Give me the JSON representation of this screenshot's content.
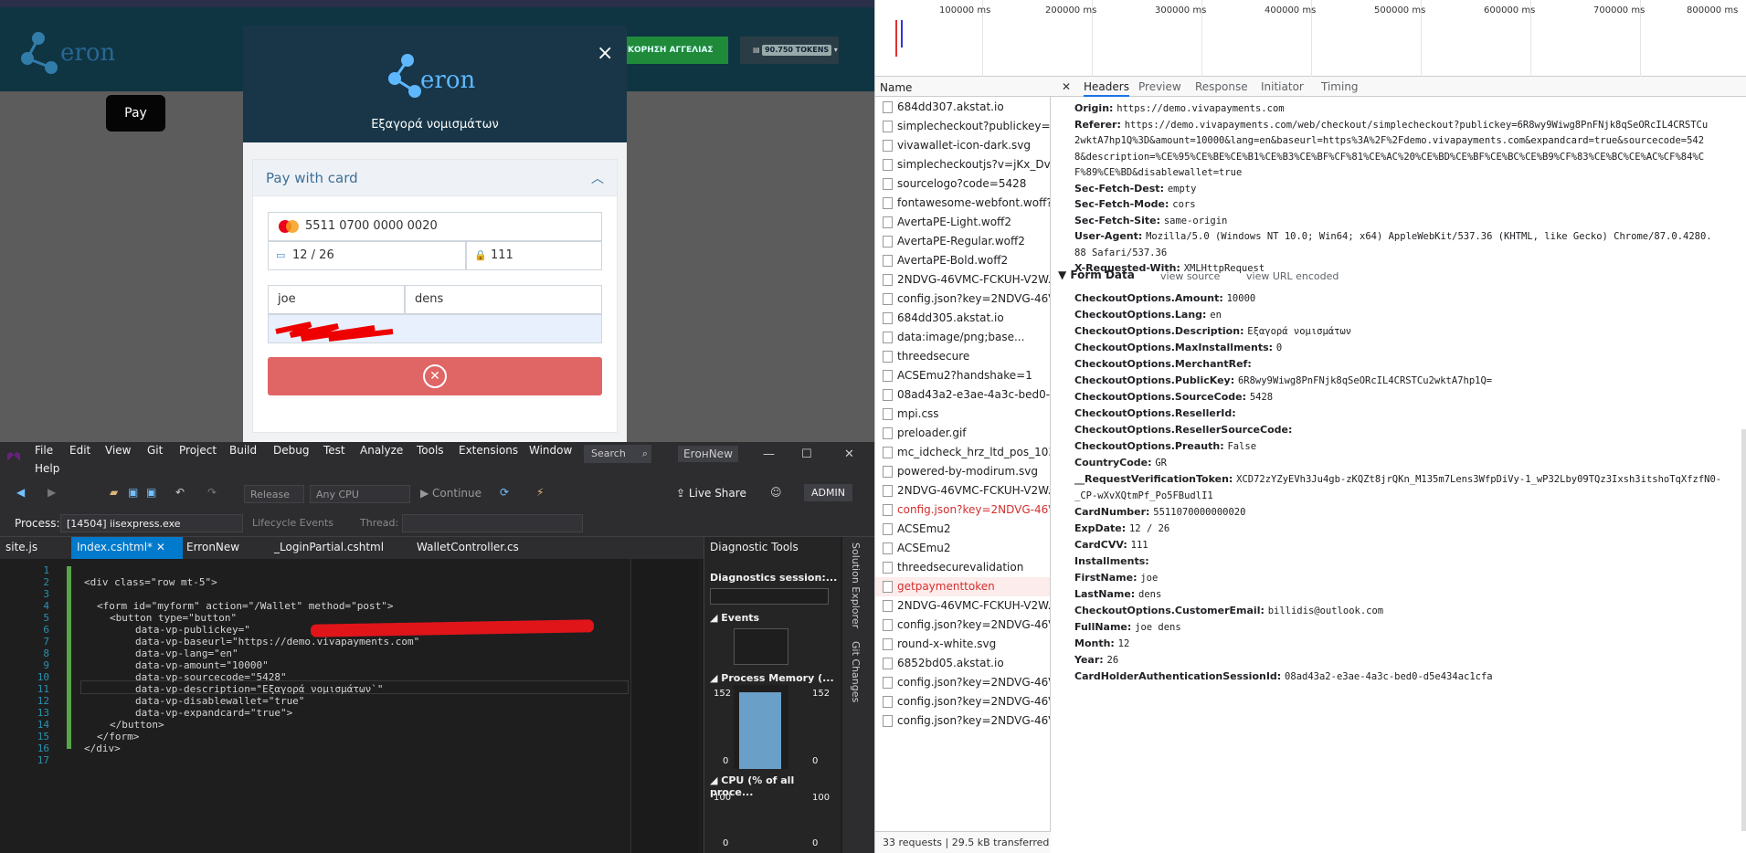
{
  "webpage": {
    "cta_label": "ΚΟΡΗΣΗ ΑΓΓΕΛΙΑΣ",
    "tokens_label": "90.750 TOKENS",
    "pay_button": "Pay",
    "modal": {
      "close": "×",
      "title": "Εξαγορά νομισμάτων",
      "panel_title": "Pay with card",
      "card_number": "5511 0700 0000 0020",
      "expiry": "12 / 26",
      "cvv": "111",
      "first_name": "joe",
      "last_name": "dens"
    }
  },
  "vs": {
    "menu": [
      "File",
      "Edit",
      "View",
      "Git",
      "Project",
      "Build",
      "Debug",
      "Test",
      "Analyze",
      "Tools",
      "Extensions",
      "Window",
      "Help"
    ],
    "search_placeholder": "Search",
    "solution": "ErонNew",
    "live_share": "Live Share",
    "admin": "ADMIN",
    "config": "Release",
    "platform": "Any CPU",
    "continue": "Continue",
    "process_label": "Process:",
    "process": "[14504] iisexpress.exe",
    "lifecycle": "Lifecycle Events",
    "thread_label": "Thread:",
    "tabs": [
      "site.js",
      "Index.cshtml*",
      "ErronNew",
      "_LoginPartial.cshtml",
      "WalletController.cs"
    ],
    "code_lines": [
      {
        "n": "1",
        "t": ""
      },
      {
        "n": "2",
        "t": "<div class=\"row mt-5\">"
      },
      {
        "n": "3",
        "t": ""
      },
      {
        "n": "4",
        "t": "<form id=\"myform\" action=\"/Wallet\" method=\"post\">"
      },
      {
        "n": "5",
        "t": "<button type=\"button\""
      },
      {
        "n": "6",
        "t": "data-vp-publickey=\""
      },
      {
        "n": "7",
        "t": "data-vp-baseurl=\"https://demo.vivapayments.com\""
      },
      {
        "n": "8",
        "t": "data-vp-lang=\"en\""
      },
      {
        "n": "9",
        "t": "data-vp-amount=\"10000\""
      },
      {
        "n": "10",
        "t": "data-vp-sourcecode=\"5428\""
      },
      {
        "n": "11",
        "t": "data-vp-description=\"Εξαγορά νομισμάτων`\""
      },
      {
        "n": "12",
        "t": "data-vp-disablewallet=\"true\""
      },
      {
        "n": "13",
        "t": "data-vp-expandcard=\"true\">"
      },
      {
        "n": "14",
        "t": "</button>"
      },
      {
        "n": "15",
        "t": "</form>"
      },
      {
        "n": "16",
        "t": "</div>"
      },
      {
        "n": "17",
        "t": ""
      }
    ],
    "diagnostic_title": "Diagnostic Tools",
    "diag_session": "Diagnostics session:...",
    "events": "Events",
    "process_memory": "Process Memory (...",
    "cpu": "CPU (% of all proce...",
    "mem_max": "152",
    "mem_min": "0",
    "cpu_max": "100",
    "cpu_min": "0",
    "side_tabs": [
      "Solution Explorer",
      "Git Changes"
    ]
  },
  "devtools": {
    "timeline_ticks": [
      "100000 ms",
      "200000 ms",
      "300000 ms",
      "400000 ms",
      "500000 ms",
      "600000 ms",
      "700000 ms",
      "800000 ms"
    ],
    "name_header": "Name",
    "requests": [
      {
        "name": "684dd307.akstat.io",
        "error": false
      },
      {
        "name": "simplecheckout?publickey=6...",
        "error": false
      },
      {
        "name": "vivawallet-icon-dark.svg",
        "error": false
      },
      {
        "name": "simplecheckoutjs?v=jKx_DvU...",
        "error": false
      },
      {
        "name": "sourcelogo?code=5428",
        "error": false
      },
      {
        "name": "fontawesome-webfont.woff?...",
        "error": false
      },
      {
        "name": "AvertaPE-Light.woff2",
        "error": false
      },
      {
        "name": "AvertaPE-Regular.woff2",
        "error": false
      },
      {
        "name": "AvertaPE-Bold.woff2",
        "error": false
      },
      {
        "name": "2NDVG-46VMC-FCKUH-V2W...",
        "error": false
      },
      {
        "name": "config.json?key=2NDVG-46V...",
        "error": false
      },
      {
        "name": "684dd305.akstat.io",
        "error": false
      },
      {
        "name": "data:image/png;base...",
        "error": false
      },
      {
        "name": "threedsecure",
        "error": false
      },
      {
        "name": "ACSEmu2?handshake=1",
        "error": false
      },
      {
        "name": "08ad43a2-e3ae-4a3c-bed0-d...",
        "error": false
      },
      {
        "name": "mpi.css",
        "error": false
      },
      {
        "name": "preloader.gif",
        "error": false
      },
      {
        "name": "mc_idcheck_hrz_ltd_pos_103...",
        "error": false
      },
      {
        "name": "powered-by-modirum.svg",
        "error": false
      },
      {
        "name": "2NDVG-46VMC-FCKUH-V2W...",
        "error": false
      },
      {
        "name": "config.json?key=2NDVG-46V...",
        "error": true
      },
      {
        "name": "ACSEmu2",
        "error": false
      },
      {
        "name": "ACSEmu2",
        "error": false
      },
      {
        "name": "threedsecurevalidation",
        "error": false
      },
      {
        "name": "getpaymenttoken",
        "error": true
      },
      {
        "name": "2NDVG-46VMC-FCKUH-V2W...",
        "error": false
      },
      {
        "name": "config.json?key=2NDVG-46V...",
        "error": false
      },
      {
        "name": "round-x-white.svg",
        "error": false
      },
      {
        "name": "6852bd05.akstat.io",
        "error": false
      },
      {
        "name": "config.json?key=2NDVG-46V...",
        "error": false
      },
      {
        "name": "config.json?key=2NDVG-46V...",
        "error": false
      },
      {
        "name": "config.json?key=2NDVG-46V...",
        "error": false
      }
    ],
    "status": "33 requests  |  29.5 kB transferred",
    "detail_tabs": [
      "Headers",
      "Preview",
      "Response",
      "Initiator",
      "Timing"
    ],
    "headers": [
      {
        "k": "Origin:",
        "v": "https://demo.vivapayments.com"
      },
      {
        "k": "Referer:",
        "v": "https://demo.vivapayments.com/web/checkout/simplecheckout?publickey=6R8wy9Wiwg8PnFNjk8qSeORcIL4CRSTCu"
      },
      {
        "k": "",
        "v": "2wktA7hp1Q%3D&amount=10000&lang=en&baseurl=https%3A%2F%2Fdemo.vivapayments.com&expandcard=true&sourcecode=542"
      },
      {
        "k": "",
        "v": "8&description=%CE%95%CE%BE%CE%B1%CE%B3%CE%BF%CF%81%CE%AC%20%CE%BD%CE%BF%CE%BC%CE%B9%CF%83%CE%BC%CE%AC%CF%84%C"
      },
      {
        "k": "",
        "v": "F%89%CE%BD&disablewallet=true"
      },
      {
        "k": "Sec-Fetch-Dest:",
        "v": "empty"
      },
      {
        "k": "Sec-Fetch-Mode:",
        "v": "cors"
      },
      {
        "k": "Sec-Fetch-Site:",
        "v": "same-origin"
      },
      {
        "k": "User-Agent:",
        "v": "Mozilla/5.0 (Windows NT 10.0; Win64; x64) AppleWebKit/537.36 (KHTML, like Gecko) Chrome/87.0.4280."
      },
      {
        "k": "",
        "v": "88 Safari/537.36"
      },
      {
        "k": "X-Requested-With:",
        "v": "XMLHttpRequest"
      }
    ],
    "form_data_title": "▼ Form Data",
    "view_source": "view source",
    "view_url_encoded": "view URL encoded",
    "form_data": [
      {
        "k": "CheckoutOptions.Amount:",
        "v": "10000"
      },
      {
        "k": "CheckoutOptions.Lang:",
        "v": "en"
      },
      {
        "k": "CheckoutOptions.Description:",
        "v": "Εξαγορά νομισμάτων"
      },
      {
        "k": "CheckoutOptions.MaxInstallments:",
        "v": "0"
      },
      {
        "k": "CheckoutOptions.MerchantRef:",
        "v": ""
      },
      {
        "k": "CheckoutOptions.PublicKey:",
        "v": "6R8wy9Wiwg8PnFNjk8qSeORcIL4CRSTCu2wktA7hp1Q="
      },
      {
        "k": "CheckoutOptions.SourceCode:",
        "v": "5428"
      },
      {
        "k": "CheckoutOptions.ResellerId:",
        "v": ""
      },
      {
        "k": "CheckoutOptions.ResellerSourceCode:",
        "v": ""
      },
      {
        "k": "CheckoutOptions.Preauth:",
        "v": "False"
      },
      {
        "k": "CountryCode:",
        "v": "GR"
      },
      {
        "k": "__RequestVerificationToken:",
        "v": "XCD72zYZyEVh3Ju4gb-zKQZt8jrQKn_M135m7Lens3WfpDiVy-1_wP32Lby09TQz3Ixsh3itshoTqXfzfN0-"
      },
      {
        "k": "",
        "v": "_CP-wXvXQtmPf_Po5FBudlI1"
      },
      {
        "k": "CardNumber:",
        "v": "5511070000000020"
      },
      {
        "k": "ExpDate:",
        "v": "12 / 26"
      },
      {
        "k": "CardCVV:",
        "v": "111"
      },
      {
        "k": "Installments:",
        "v": ""
      },
      {
        "k": "FirstName:",
        "v": "joe"
      },
      {
        "k": "LastName:",
        "v": "dens"
      },
      {
        "k": "CheckoutOptions.CustomerEmail:",
        "v": "billidis@outlook.com"
      },
      {
        "k": "FullName:",
        "v": "joe dens"
      },
      {
        "k": "Month:",
        "v": "12"
      },
      {
        "k": "Year:",
        "v": "26"
      },
      {
        "k": "CardHolderAuthenticationSessionId:",
        "v": "08ad43a2-e3ae-4a3c-bed0-d5e434ac1cfa"
      }
    ]
  }
}
